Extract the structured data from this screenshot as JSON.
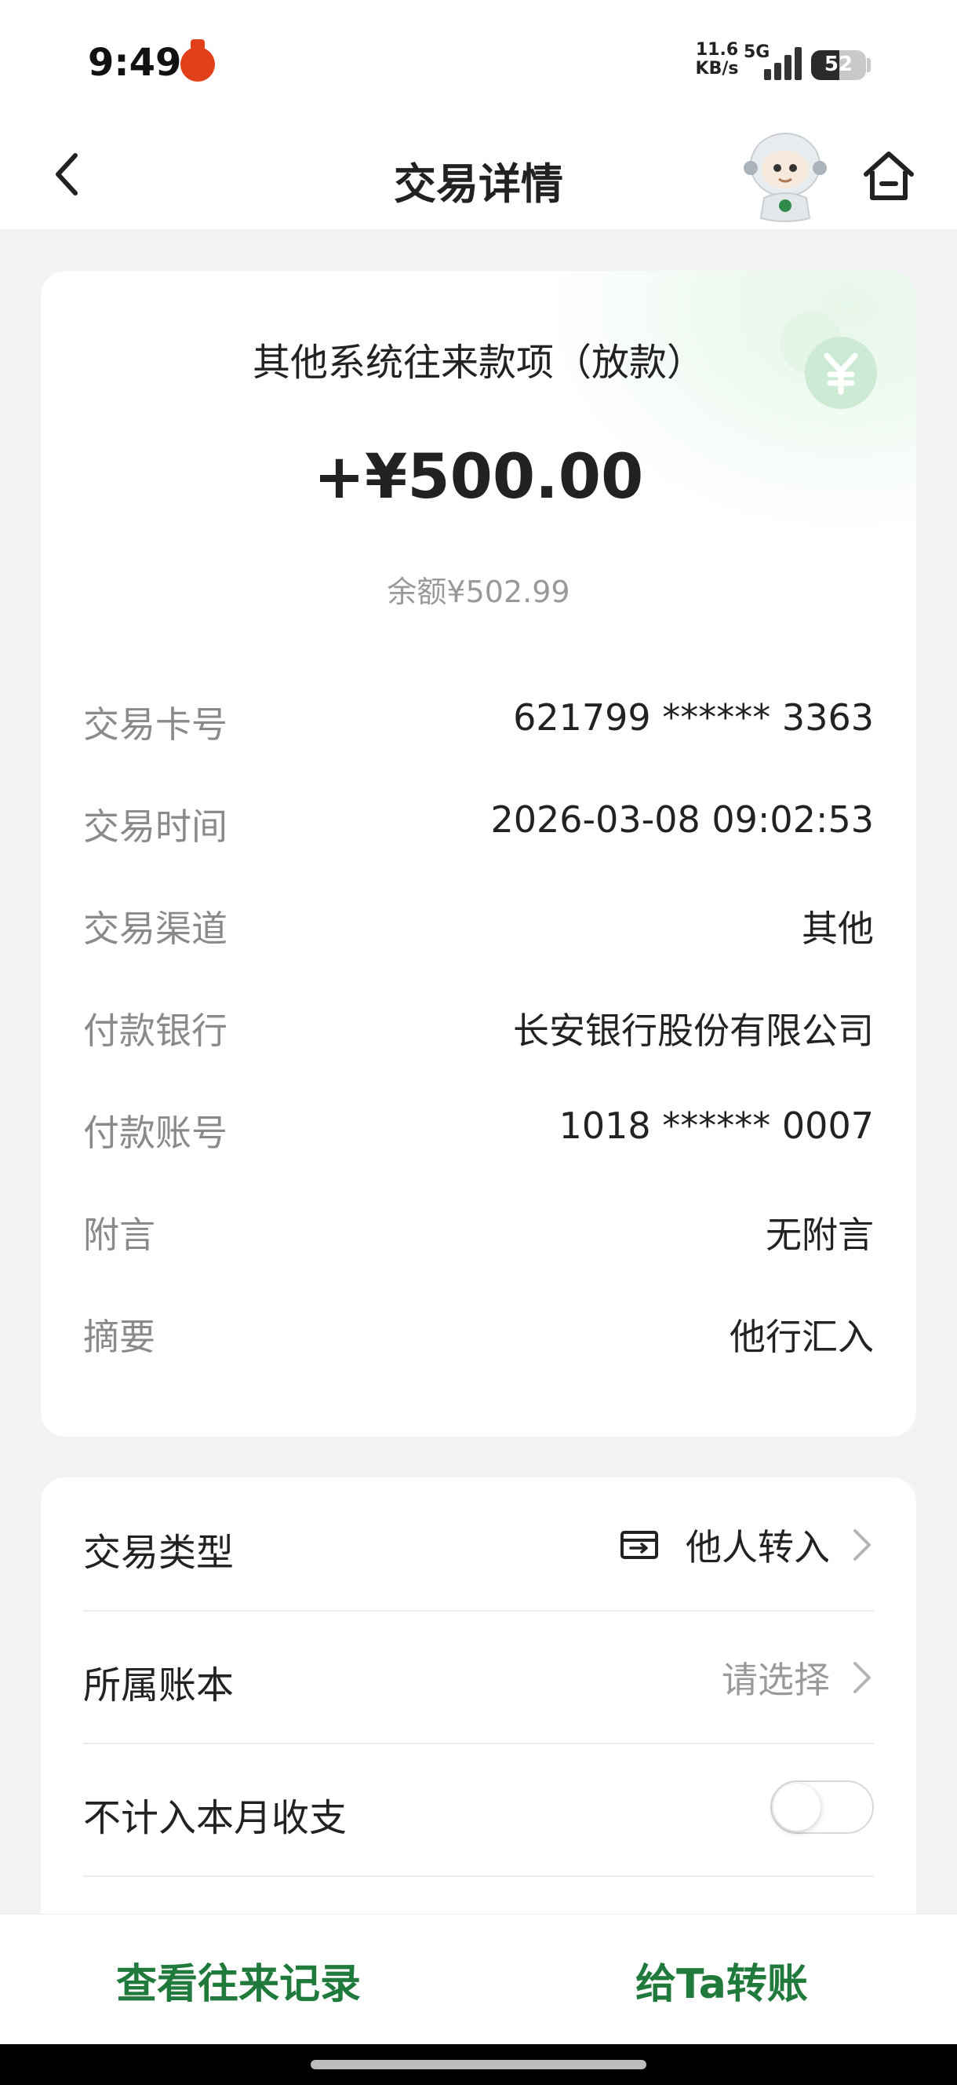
{
  "status_bar": {
    "time": "9:49",
    "network_speed_value": "11.6",
    "network_speed_unit": "KB/s",
    "network_type": "5G",
    "battery": "52"
  },
  "header": {
    "title": "交易详情",
    "icons": [
      "back-icon",
      "mascot-icon",
      "home-icon"
    ]
  },
  "transaction": {
    "title": "其他系统往来款项（放款）",
    "amount": "+¥500.00",
    "balance": "余额¥502.99",
    "details": [
      {
        "label": "交易卡号",
        "value": "621799 ****** 3363"
      },
      {
        "label": "交易时间",
        "value": "2026-03-08 09:02:53"
      },
      {
        "label": "交易渠道",
        "value": "其他"
      },
      {
        "label": "付款银行",
        "value": "长安银行股份有限公司"
      },
      {
        "label": "付款账号",
        "value": "1018 ****** 0007"
      },
      {
        "label": "附言",
        "value": "无附言"
      },
      {
        "label": "摘要",
        "value": "他行汇入"
      }
    ]
  },
  "options": {
    "type": {
      "label": "交易类型",
      "value": "他人转入"
    },
    "ledger": {
      "label": "所属账本",
      "value": "请选择"
    },
    "exclude": {
      "label": "不计入本月收支",
      "toggle_on": false
    }
  },
  "bottom": {
    "history_label": "查看往来记录",
    "transfer_label": "给Ta转账"
  },
  "colors": {
    "accent_green": "#1f7a3b",
    "decor_green": "#bfe6c8",
    "background": "#f2f3f5"
  }
}
